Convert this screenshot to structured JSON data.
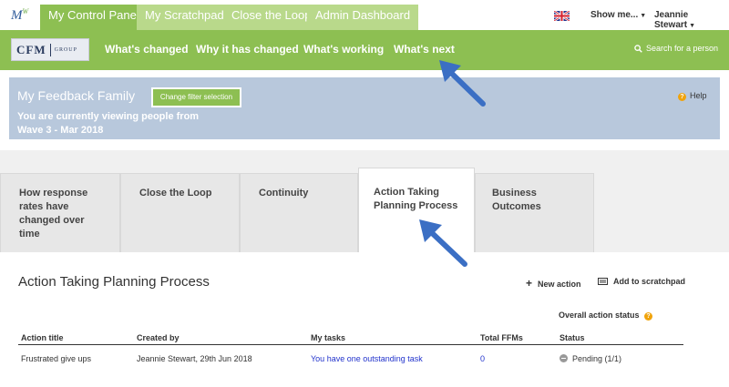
{
  "app": {
    "logo": "MW"
  },
  "top_tabs": [
    {
      "label": "My Control Panel",
      "active": true
    },
    {
      "label": "My Scratchpad",
      "active": false
    },
    {
      "label": "Close the Loop",
      "active": false
    },
    {
      "label": "Admin Dashboard",
      "active": false
    }
  ],
  "user_menu": {
    "language_icon": "uk-flag-icon",
    "show_me": "Show me...",
    "user": "Jeannie Stewart"
  },
  "brand": {
    "name": "CFM",
    "group": "GROUP"
  },
  "nav": {
    "links": [
      "What's changed",
      "Why it has changed",
      "What's working",
      "What's next"
    ],
    "search": "Search for a person"
  },
  "feedback": {
    "title": "My Feedback Family",
    "filter_button": "Change filter selection",
    "viewing": "You are currently viewing people from",
    "wave": "Wave 3 - Mar 2018",
    "help": "Help"
  },
  "tabs": [
    {
      "label": "How response rates have changed over time",
      "active": false
    },
    {
      "label": "Close the Loop",
      "active": false
    },
    {
      "label": "Continuity",
      "active": false
    },
    {
      "label": "Action Taking Planning Process",
      "active": true
    },
    {
      "label": "Business Outcomes",
      "active": false
    }
  ],
  "content": {
    "title": "Action Taking Planning Process",
    "new_action": "New action",
    "add_scratchpad": "Add to scratchpad",
    "overall_status": "Overall action status",
    "table": {
      "headers": [
        "Action title",
        "Created by",
        "My tasks",
        "Total FFMs",
        "Status"
      ],
      "rows": [
        [
          "Frustrated give ups",
          "Jeannie Stewart, 29th Jun 2018",
          "You have one outstanding task",
          "0",
          "Pending (1/1)"
        ]
      ]
    }
  },
  "colors": {
    "brand_green": "#8dbf52",
    "light_green": "#b9d98b",
    "panel_blue": "#b8c8dc",
    "link_blue": "#2233cc",
    "arrow_blue": "#3b6fc4"
  }
}
